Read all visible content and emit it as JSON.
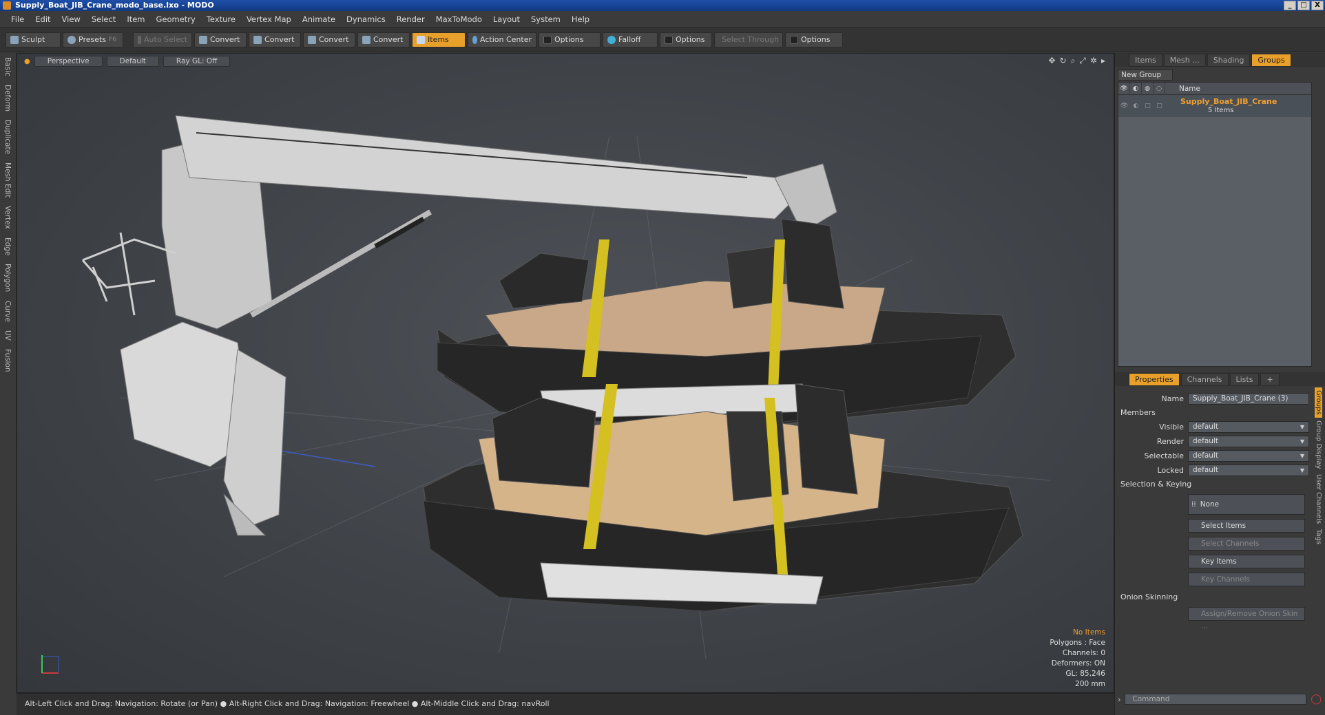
{
  "window": {
    "title": "Supply_Boat_JIB_Crane_modo_base.lxo - MODO",
    "buttons": [
      "_",
      "□",
      "X"
    ]
  },
  "menu": [
    "File",
    "Edit",
    "View",
    "Select",
    "Item",
    "Geometry",
    "Texture",
    "Vertex Map",
    "Animate",
    "Dynamics",
    "Render",
    "MaxToModo",
    "Layout",
    "System",
    "Help"
  ],
  "toolbar": {
    "sculpt": "Sculpt",
    "presets": "Presets",
    "presets_key": "F6",
    "auto_select": "Auto Select",
    "convert1": "Convert",
    "convert2": "Convert",
    "convert3": "Convert",
    "convert4": "Convert",
    "items": "Items",
    "action_center": "Action Center",
    "options1": "Options",
    "falloff": "Falloff",
    "options2": "Options",
    "select_through": "Select Through",
    "options3": "Options"
  },
  "left_tabs": [
    "Basic",
    "Deform",
    "Duplicate",
    "Mesh Edit",
    "Vertex",
    "Edge",
    "Polygon",
    "Curve",
    "UV",
    "Fusion"
  ],
  "viewport": {
    "view": "Perspective",
    "shading": "Default",
    "raygl": "Ray GL: Off",
    "info": {
      "selection": "No Items",
      "polygons": "Polygons : Face",
      "channels": "Channels: 0",
      "deformers": "Deformers: ON",
      "gl": "GL: 85,246",
      "scale": "200 mm"
    }
  },
  "status": "Alt-Left Click and Drag: Navigation: Rotate (or Pan) ● Alt-Right Click and Drag: Navigation: Freewheel ● Alt-Middle Click and Drag: navRoll",
  "right_panel": {
    "tabs": [
      "Items",
      "Mesh ...",
      "Shading",
      "Groups"
    ],
    "new_group": "New Group",
    "list_header": "Name",
    "group_name": "Supply_Boat_JIB_Crane",
    "group_count": "5 Items",
    "prop_tabs": [
      "Properties",
      "Channels",
      "Lists",
      "+"
    ],
    "name_label": "Name",
    "name_value": "Supply_Boat_JIB_Crane (3)",
    "members": "Members",
    "visible_label": "Visible",
    "render_label": "Render",
    "selectable_label": "Selectable",
    "locked_label": "Locked",
    "default": "default",
    "selection_keying": "Selection & Keying",
    "none": "None",
    "select_items": "Select Items",
    "select_channels": "Select Channels",
    "key_items": "Key Items",
    "key_channels": "Key Channels",
    "onion": "Onion Skinning",
    "assign_onion": "Assign/Remove Onion Skin ...",
    "vtabs": [
      "Groups",
      "Group Display",
      "User Channels",
      "Tags"
    ],
    "command": "Command"
  }
}
